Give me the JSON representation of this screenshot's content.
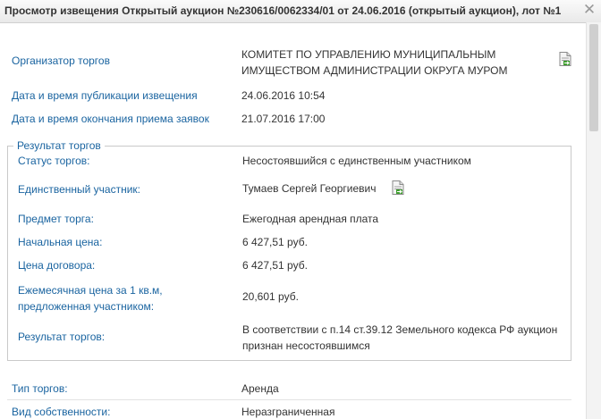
{
  "window": {
    "title": "Просмотр извещения Открытый аукцион №230616/0062334/01 от 24.06.2016 (открытый аукцион), лот №1",
    "close_glyph": "✕"
  },
  "organizer": {
    "label": "Организатор торгов",
    "value_line1": "КОМИТЕТ ПО УПРАВЛЕНИЮ МУНИЦИПАЛЬНЫМ",
    "value_line2": "ИМУЩЕСТВОМ АДМИНИСТРАЦИИ ОКРУГА МУРОМ",
    "icon": "document-icon"
  },
  "publication": {
    "label": "Дата и время публикации извещения",
    "value": "24.06.2016 10:54"
  },
  "deadline": {
    "label": "Дата и время окончания приема заявок",
    "value": "21.07.2016 17:00"
  },
  "result_section": {
    "legend": "Результат торгов",
    "rows": [
      {
        "label": "Статус торгов:",
        "value": "Несостоявшийся с единственным участником"
      },
      {
        "label": "Единственный участник:",
        "value": "Тумаев Сергей Георгиевич"
      },
      {
        "label": "Предмет торга:",
        "value": "Ежегодная арендная плата"
      },
      {
        "label": "Начальная цена:",
        "value": "6 427,51 руб."
      },
      {
        "label": "Цена договора:",
        "value": "6 427,51 руб."
      },
      {
        "label_line1": "Ежемесячная цена за 1 кв.м,",
        "label_line2": "предложенная участником:",
        "value": "20,601 руб."
      },
      {
        "label": "Результат торгов:",
        "value_line1": "В соответствии с п.14 ст.39.12 Земельного кодекса РФ аукцион",
        "value_line2": "признан несостоявшимся"
      }
    ]
  },
  "auction_type": {
    "label": "Тип торгов:",
    "value": "Аренда"
  },
  "ownership": {
    "label": "Вид собственности:",
    "value": "Неразграниченная"
  },
  "colors": {
    "label": "#1a64a0",
    "value": "#333333",
    "border": "#c9c9c9"
  }
}
